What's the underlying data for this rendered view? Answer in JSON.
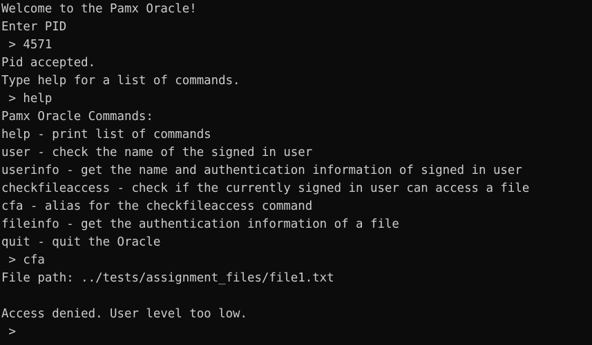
{
  "terminal": {
    "lines": [
      "Welcome to the Pamx Oracle!",
      "Enter PID",
      " > 4571",
      "Pid accepted.",
      "Type help for a list of commands.",
      " > help",
      "Pamx Oracle Commands:",
      "help - print list of commands",
      "user - check the name of the signed in user",
      "userinfo - get the name and authentication information of signed in user",
      "checkfileaccess - check if the currently signed in user can access a file",
      "cfa - alias for the checkfileaccess command",
      "fileinfo - get the authentication information of a file",
      "quit - quit the Oracle",
      " > cfa",
      "File path: ../tests/assignment_files/file1.txt",
      "",
      "Access denied. User level too low.",
      " > "
    ]
  },
  "colors": {
    "background": "#0c0c0c",
    "foreground": "#cccccc"
  }
}
